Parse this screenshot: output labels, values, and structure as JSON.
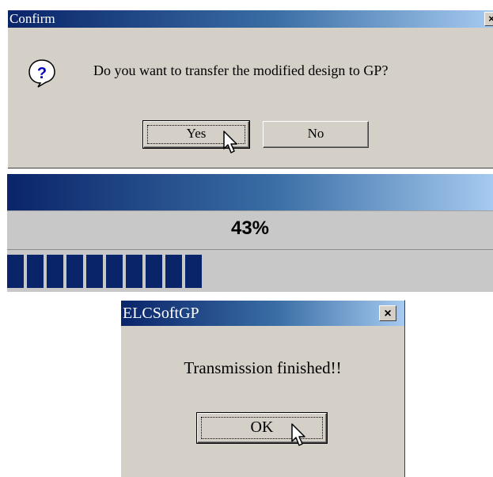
{
  "confirm_dialog": {
    "title": "Confirm",
    "close_label": "×",
    "icon": "question-icon",
    "message": "Do you want to transfer the modified design to GP?",
    "yes_label": "Yes",
    "no_label": "No"
  },
  "progress": {
    "percent_text": "43%",
    "value": 0.43,
    "colors": {
      "bar": "#0a246a",
      "track": "#c8c8c8"
    }
  },
  "done_dialog": {
    "title": "ELCSoftGP",
    "close_label": "×",
    "message": "Transmission finished!!",
    "ok_label": "OK"
  },
  "colors": {
    "dialog_face": "#d4d0c8",
    "titlebar_start": "#0a246a",
    "titlebar_end": "#a6caf0"
  }
}
